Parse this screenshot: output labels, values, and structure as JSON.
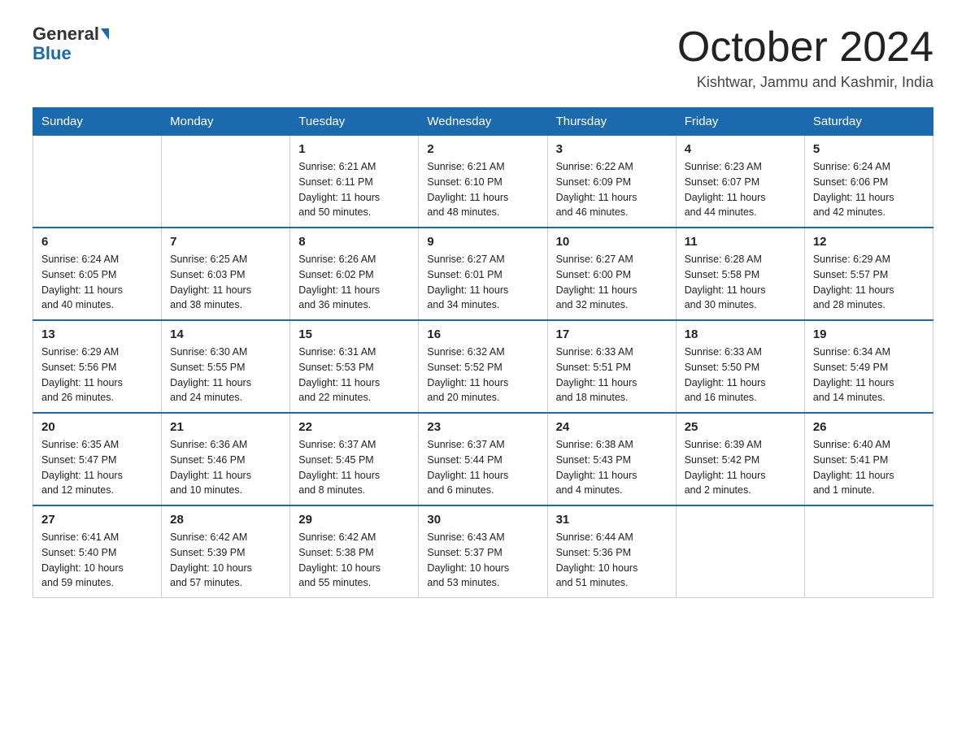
{
  "header": {
    "logo_line1": "General",
    "logo_line2": "Blue",
    "month": "October 2024",
    "location": "Kishtwar, Jammu and Kashmir, India"
  },
  "days_of_week": [
    "Sunday",
    "Monday",
    "Tuesday",
    "Wednesday",
    "Thursday",
    "Friday",
    "Saturday"
  ],
  "weeks": [
    [
      {
        "day": "",
        "info": ""
      },
      {
        "day": "",
        "info": ""
      },
      {
        "day": "1",
        "info": "Sunrise: 6:21 AM\nSunset: 6:11 PM\nDaylight: 11 hours\nand 50 minutes."
      },
      {
        "day": "2",
        "info": "Sunrise: 6:21 AM\nSunset: 6:10 PM\nDaylight: 11 hours\nand 48 minutes."
      },
      {
        "day": "3",
        "info": "Sunrise: 6:22 AM\nSunset: 6:09 PM\nDaylight: 11 hours\nand 46 minutes."
      },
      {
        "day": "4",
        "info": "Sunrise: 6:23 AM\nSunset: 6:07 PM\nDaylight: 11 hours\nand 44 minutes."
      },
      {
        "day": "5",
        "info": "Sunrise: 6:24 AM\nSunset: 6:06 PM\nDaylight: 11 hours\nand 42 minutes."
      }
    ],
    [
      {
        "day": "6",
        "info": "Sunrise: 6:24 AM\nSunset: 6:05 PM\nDaylight: 11 hours\nand 40 minutes."
      },
      {
        "day": "7",
        "info": "Sunrise: 6:25 AM\nSunset: 6:03 PM\nDaylight: 11 hours\nand 38 minutes."
      },
      {
        "day": "8",
        "info": "Sunrise: 6:26 AM\nSunset: 6:02 PM\nDaylight: 11 hours\nand 36 minutes."
      },
      {
        "day": "9",
        "info": "Sunrise: 6:27 AM\nSunset: 6:01 PM\nDaylight: 11 hours\nand 34 minutes."
      },
      {
        "day": "10",
        "info": "Sunrise: 6:27 AM\nSunset: 6:00 PM\nDaylight: 11 hours\nand 32 minutes."
      },
      {
        "day": "11",
        "info": "Sunrise: 6:28 AM\nSunset: 5:58 PM\nDaylight: 11 hours\nand 30 minutes."
      },
      {
        "day": "12",
        "info": "Sunrise: 6:29 AM\nSunset: 5:57 PM\nDaylight: 11 hours\nand 28 minutes."
      }
    ],
    [
      {
        "day": "13",
        "info": "Sunrise: 6:29 AM\nSunset: 5:56 PM\nDaylight: 11 hours\nand 26 minutes."
      },
      {
        "day": "14",
        "info": "Sunrise: 6:30 AM\nSunset: 5:55 PM\nDaylight: 11 hours\nand 24 minutes."
      },
      {
        "day": "15",
        "info": "Sunrise: 6:31 AM\nSunset: 5:53 PM\nDaylight: 11 hours\nand 22 minutes."
      },
      {
        "day": "16",
        "info": "Sunrise: 6:32 AM\nSunset: 5:52 PM\nDaylight: 11 hours\nand 20 minutes."
      },
      {
        "day": "17",
        "info": "Sunrise: 6:33 AM\nSunset: 5:51 PM\nDaylight: 11 hours\nand 18 minutes."
      },
      {
        "day": "18",
        "info": "Sunrise: 6:33 AM\nSunset: 5:50 PM\nDaylight: 11 hours\nand 16 minutes."
      },
      {
        "day": "19",
        "info": "Sunrise: 6:34 AM\nSunset: 5:49 PM\nDaylight: 11 hours\nand 14 minutes."
      }
    ],
    [
      {
        "day": "20",
        "info": "Sunrise: 6:35 AM\nSunset: 5:47 PM\nDaylight: 11 hours\nand 12 minutes."
      },
      {
        "day": "21",
        "info": "Sunrise: 6:36 AM\nSunset: 5:46 PM\nDaylight: 11 hours\nand 10 minutes."
      },
      {
        "day": "22",
        "info": "Sunrise: 6:37 AM\nSunset: 5:45 PM\nDaylight: 11 hours\nand 8 minutes."
      },
      {
        "day": "23",
        "info": "Sunrise: 6:37 AM\nSunset: 5:44 PM\nDaylight: 11 hours\nand 6 minutes."
      },
      {
        "day": "24",
        "info": "Sunrise: 6:38 AM\nSunset: 5:43 PM\nDaylight: 11 hours\nand 4 minutes."
      },
      {
        "day": "25",
        "info": "Sunrise: 6:39 AM\nSunset: 5:42 PM\nDaylight: 11 hours\nand 2 minutes."
      },
      {
        "day": "26",
        "info": "Sunrise: 6:40 AM\nSunset: 5:41 PM\nDaylight: 11 hours\nand 1 minute."
      }
    ],
    [
      {
        "day": "27",
        "info": "Sunrise: 6:41 AM\nSunset: 5:40 PM\nDaylight: 10 hours\nand 59 minutes."
      },
      {
        "day": "28",
        "info": "Sunrise: 6:42 AM\nSunset: 5:39 PM\nDaylight: 10 hours\nand 57 minutes."
      },
      {
        "day": "29",
        "info": "Sunrise: 6:42 AM\nSunset: 5:38 PM\nDaylight: 10 hours\nand 55 minutes."
      },
      {
        "day": "30",
        "info": "Sunrise: 6:43 AM\nSunset: 5:37 PM\nDaylight: 10 hours\nand 53 minutes."
      },
      {
        "day": "31",
        "info": "Sunrise: 6:44 AM\nSunset: 5:36 PM\nDaylight: 10 hours\nand 51 minutes."
      },
      {
        "day": "",
        "info": ""
      },
      {
        "day": "",
        "info": ""
      }
    ]
  ]
}
